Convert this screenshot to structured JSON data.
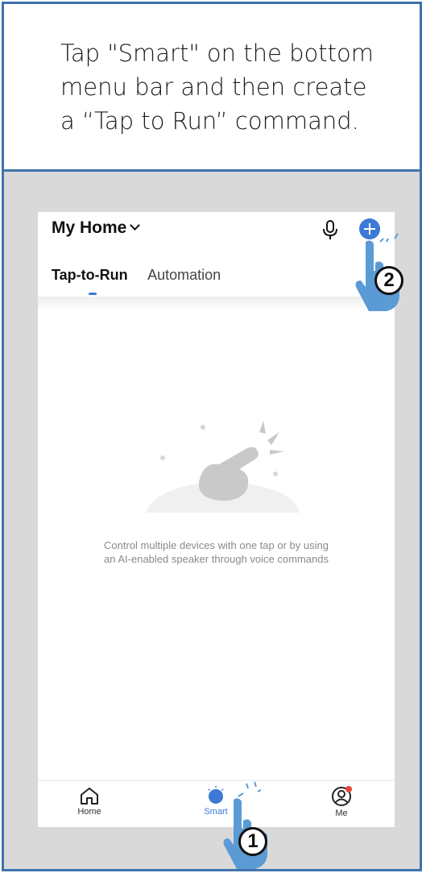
{
  "instruction": {
    "line1": "Tap \"Smart\" on the bottom",
    "line2": "menu bar and then create",
    "line3": "a “Tap to Run” command."
  },
  "header": {
    "title": "My Home",
    "mic_icon": "microphone-icon",
    "add_icon": "plus-circle-icon"
  },
  "tabs": [
    {
      "label": "Tap-to-Run",
      "active": true
    },
    {
      "label": "Automation",
      "active": false
    }
  ],
  "empty_state": {
    "line1": "Control multiple devices with one tap or by using",
    "line2": "an AI-enabled speaker through voice commands"
  },
  "tabbar": [
    {
      "label": "Home",
      "icon": "house-icon"
    },
    {
      "label": "Smart",
      "icon": "smart-icon",
      "active": true
    },
    {
      "label": "Me",
      "icon": "user-icon"
    }
  ],
  "steps": {
    "step1": "1",
    "step2": "2"
  },
  "colors": {
    "frame": "#3f73ad",
    "accent": "#3d79d6",
    "hand": "#5b9bd5",
    "notification": "#e8473a"
  }
}
